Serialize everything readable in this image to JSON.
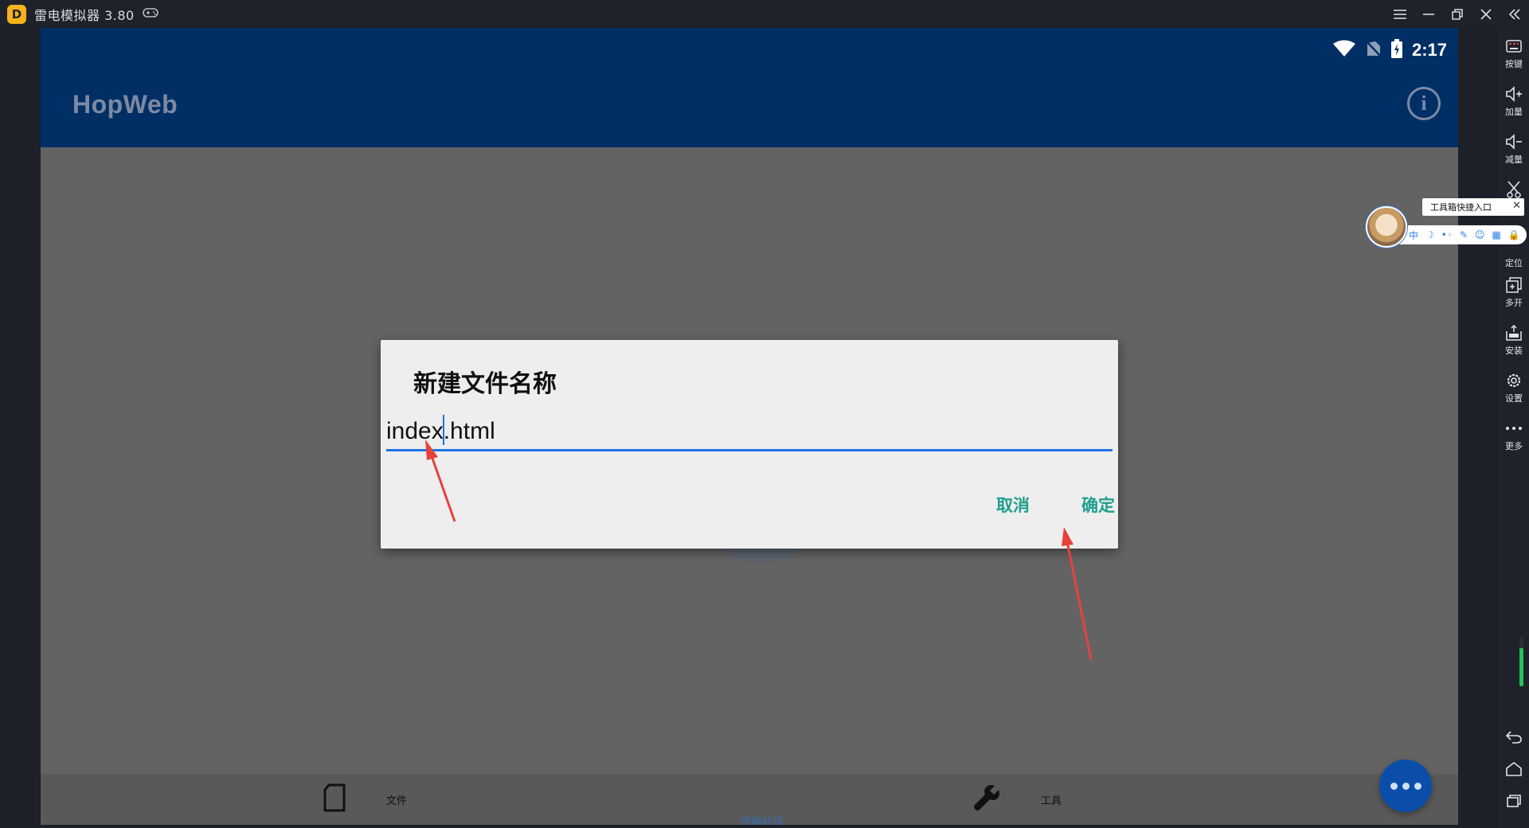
{
  "window": {
    "title": "雷电模拟器 3.80",
    "logo_glyph": "D"
  },
  "right_toolbar": [
    {
      "id": "keys",
      "label": "按键",
      "icon": "keyboard-icon"
    },
    {
      "id": "vol-up",
      "label": "加量",
      "icon": "volume-up-icon"
    },
    {
      "id": "vol-down",
      "label": "减量",
      "icon": "volume-down-icon"
    },
    {
      "id": "screenshot",
      "label": "",
      "icon": "scissors-icon"
    },
    {
      "id": "locate",
      "label": "定位",
      "icon": "location-icon"
    },
    {
      "id": "multi",
      "label": "多开",
      "icon": "multi-instance-icon"
    },
    {
      "id": "install",
      "label": "安装",
      "icon": "apk-install-icon"
    },
    {
      "id": "settings",
      "label": "设置",
      "icon": "gear-icon"
    },
    {
      "id": "more",
      "label": "更多",
      "icon": "more-dots-icon"
    }
  ],
  "volume_level": 0.78,
  "float_widget": {
    "tooltip": "工具箱快捷入口",
    "bar_items": [
      "中",
      "☽",
      "•◦",
      "✎",
      "☺",
      "▦",
      "🔒"
    ]
  },
  "status_bar": {
    "time": "2:17"
  },
  "app": {
    "title": "HopWeb"
  },
  "dialog": {
    "title": "新建文件名称",
    "input_value": "index.html",
    "cancel_label": "取消",
    "confirm_label": "确定"
  },
  "bottom_nav": {
    "file_label": "文件",
    "tools_label": "工具",
    "community_label": "流星社区"
  },
  "colors": {
    "appbar": "#002f66",
    "accent_button": "#1e9e8d",
    "input_underline": "#1e73e8",
    "fab": "#0a4eaa",
    "annotation_arrow": "#e8413b"
  }
}
